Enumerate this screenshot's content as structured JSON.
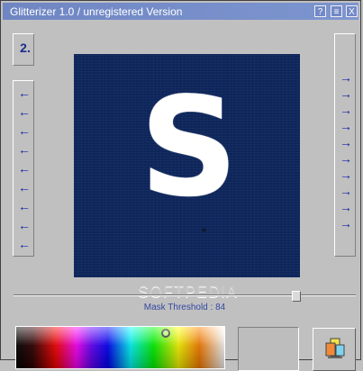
{
  "window": {
    "title": "Glitterizer 1.0 / unregistered Version",
    "title_buttons": {
      "help": "?",
      "minimize": "≡",
      "close": "X"
    }
  },
  "left_panel": {
    "step_label": "2.",
    "arrows": [
      "←",
      "←",
      "←",
      "←",
      "←",
      "←",
      "←",
      "←",
      "←"
    ]
  },
  "right_panel": {
    "arrows": [
      "→",
      "→",
      "→",
      "→",
      "→",
      "→",
      "→",
      "→",
      "→",
      "→"
    ]
  },
  "preview": {
    "letter": "S"
  },
  "slider": {
    "label": "Mask Threshold : 84",
    "value": 84
  },
  "watermark": "SOFTPEDIA",
  "colors": {
    "title_bg": "#7288c8",
    "preview_bg": "#0d255a",
    "arrow_color": "#1623a5"
  },
  "icons": {
    "help": "help-icon",
    "minimize": "minimize-icon",
    "close": "close-icon",
    "tools": "tools-icon"
  }
}
